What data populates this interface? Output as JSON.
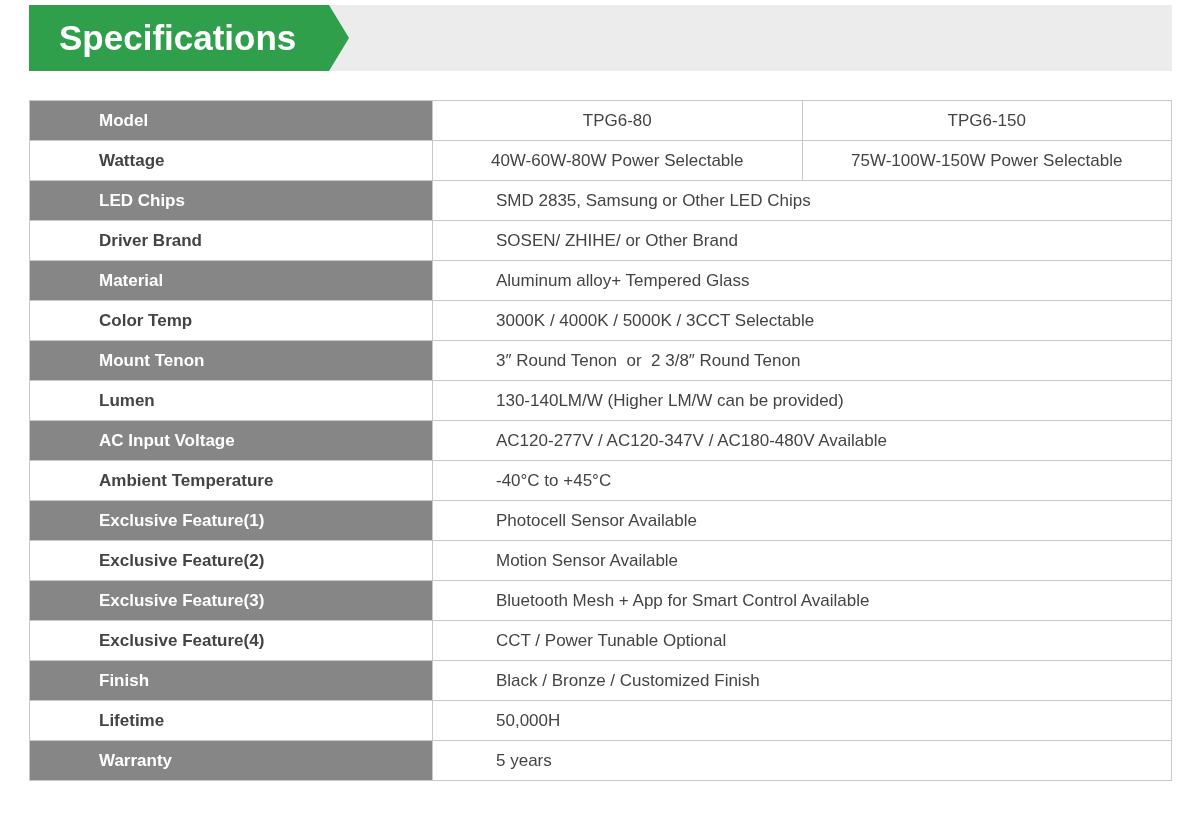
{
  "title": "Specifications",
  "rows": [
    {
      "label": "Model",
      "highlighted": true,
      "values": [
        "TPG6-80",
        "TPG6-150"
      ]
    },
    {
      "label": "Wattage",
      "highlighted": false,
      "values": [
        "40W-60W-80W Power Selectable",
        "75W-100W-150W Power Selectable"
      ]
    },
    {
      "label": "LED Chips",
      "highlighted": true,
      "values": [
        "SMD 2835, Samsung or Other LED Chips"
      ]
    },
    {
      "label": "Driver Brand",
      "highlighted": false,
      "values": [
        "SOSEN/ ZHIHE/ or Other Brand"
      ]
    },
    {
      "label": "Material",
      "highlighted": true,
      "values": [
        "Aluminum alloy+ Tempered Glass"
      ]
    },
    {
      "label": "Color Temp",
      "highlighted": false,
      "values": [
        "3000K / 4000K / 5000K / 3CCT Selectable"
      ]
    },
    {
      "label": "Mount Tenon",
      "highlighted": true,
      "values": [
        "3″ Round Tenon  or  2 3/8″ Round Tenon"
      ]
    },
    {
      "label": "Lumen",
      "highlighted": false,
      "values": [
        "130-140LM/W (Higher LM/W can be provided)"
      ]
    },
    {
      "label": "AC Input Voltage",
      "highlighted": true,
      "values": [
        "AC120-277V / AC120-347V / AC180-480V Available"
      ]
    },
    {
      "label": "Ambient Temperature",
      "highlighted": false,
      "values": [
        "-40°C to +45°C"
      ]
    },
    {
      "label": "Exclusive Feature(1)",
      "highlighted": true,
      "values": [
        "Photocell Sensor Available"
      ]
    },
    {
      "label": "Exclusive Feature(2)",
      "highlighted": false,
      "values": [
        "Motion Sensor Available"
      ]
    },
    {
      "label": "Exclusive Feature(3)",
      "highlighted": true,
      "values": [
        "Bluetooth Mesh + App for Smart Control Available"
      ]
    },
    {
      "label": "Exclusive Feature(4)",
      "highlighted": false,
      "values": [
        "CCT / Power Tunable Optional"
      ]
    },
    {
      "label": "Finish",
      "highlighted": true,
      "values": [
        "Black / Bronze / Customized Finish"
      ]
    },
    {
      "label": "Lifetime",
      "highlighted": false,
      "values": [
        "50,000H"
      ]
    },
    {
      "label": "Warranty",
      "highlighted": true,
      "values": [
        "5 years"
      ]
    }
  ]
}
